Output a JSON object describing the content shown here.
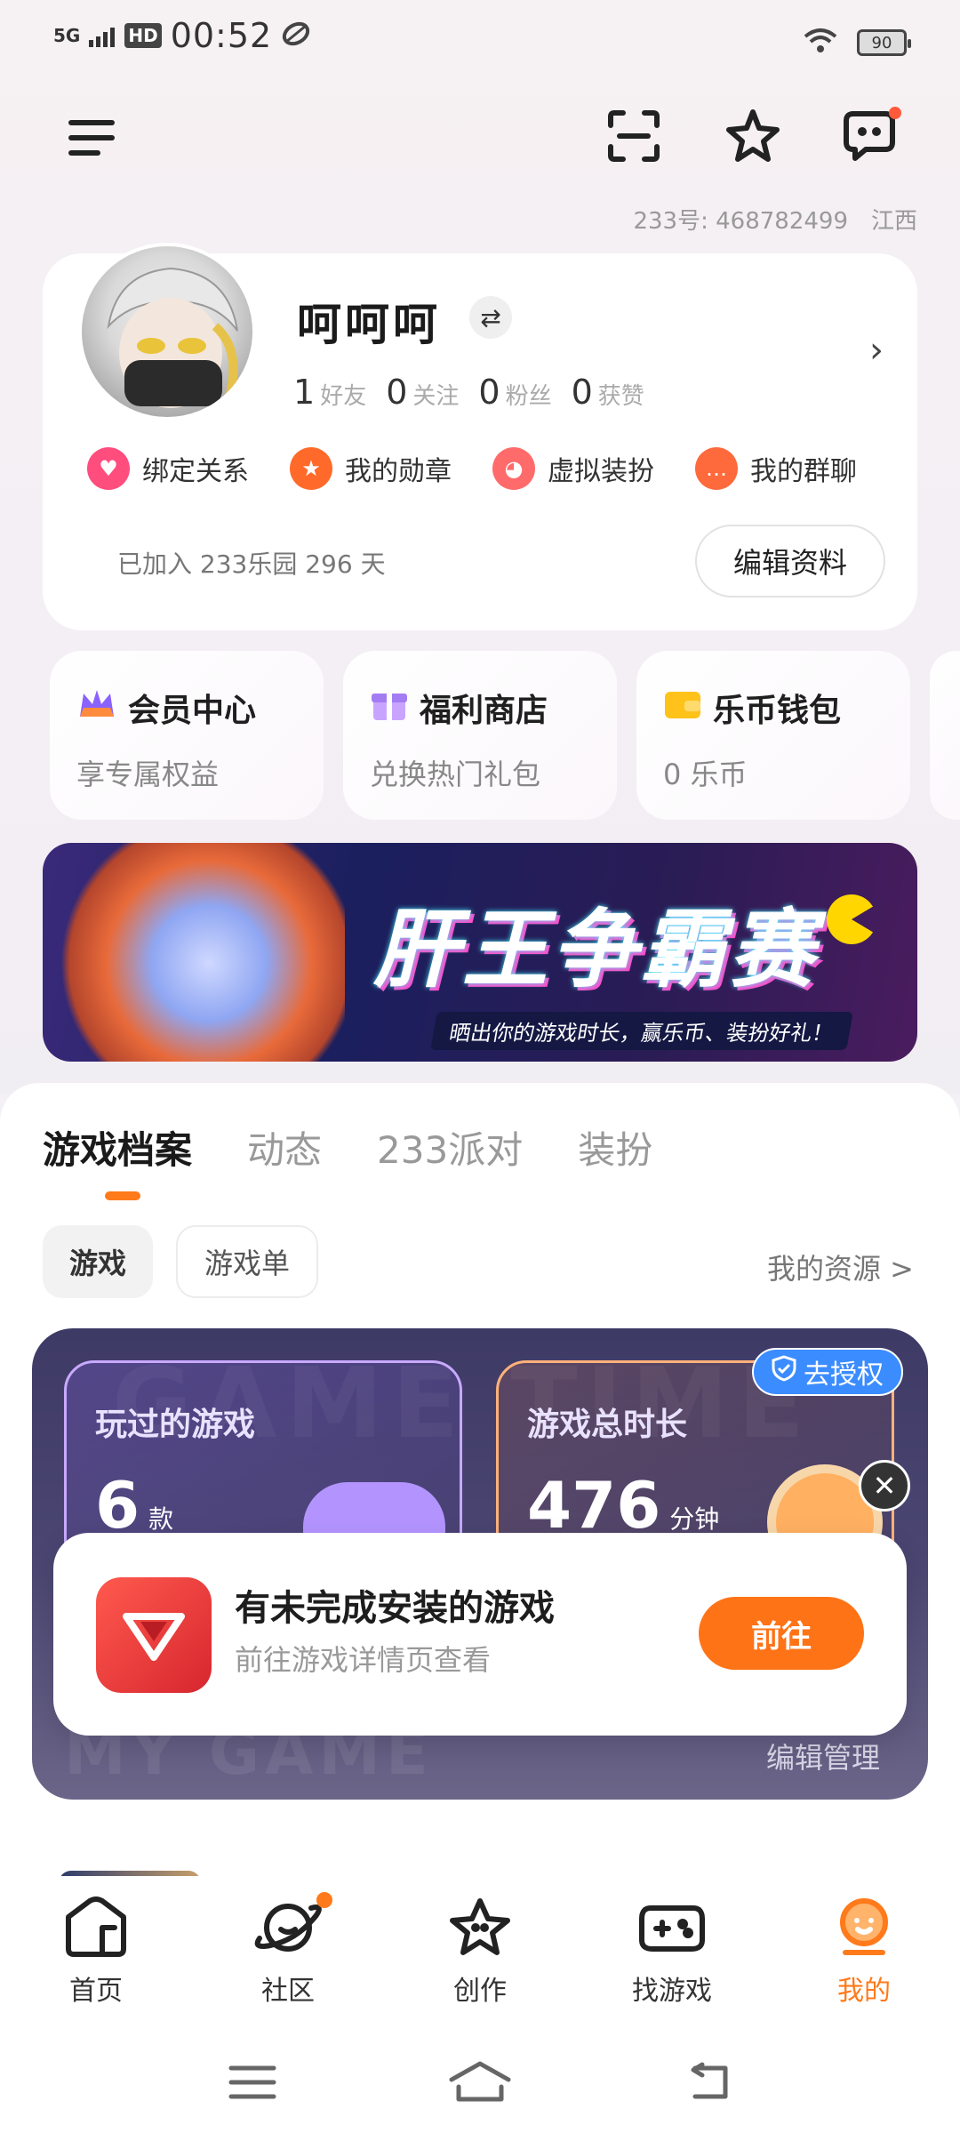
{
  "status_bar": {
    "network": "5G",
    "hd": "HD",
    "time": "00:52",
    "battery": "90"
  },
  "profile": {
    "id_label": "233号: 468782499",
    "location": "江西",
    "username": "呵呵呵",
    "stats": [
      {
        "value": "1",
        "label": "好友"
      },
      {
        "value": "0",
        "label": "关注"
      },
      {
        "value": "0",
        "label": "粉丝"
      },
      {
        "value": "0",
        "label": "获赞"
      }
    ],
    "quick_links": [
      {
        "label": "绑定关系",
        "icon": "heart-icon",
        "color": "#ff4d7d"
      },
      {
        "label": "我的勋章",
        "icon": "medal-icon",
        "color": "#ff6a2b"
      },
      {
        "label": "虚拟装扮",
        "icon": "cat-icon",
        "color": "#ff6b6b"
      },
      {
        "label": "我的群聊",
        "icon": "chat-icon",
        "color": "#ff6a3c"
      }
    ],
    "joined_text": "已加入 233乐园 296 天",
    "edit_button": "编辑资料"
  },
  "tiles": [
    {
      "title": "会员中心",
      "subtitle": "享专属权益",
      "icon": "crown-icon"
    },
    {
      "title": "福利商店",
      "subtitle": "兑换热门礼包",
      "icon": "gift-icon"
    },
    {
      "title": "乐币钱包",
      "subtitle": "0 乐币",
      "icon": "wallet-icon"
    }
  ],
  "banner": {
    "title": "肝王争霸赛",
    "subtitle": "晒出你的游戏时长，赢乐币、装扮好礼！"
  },
  "tabs": [
    "游戏档案",
    "动态",
    "233派对",
    "装扮"
  ],
  "chips": [
    "游戏",
    "游戏单"
  ],
  "my_resources": "我的资源 >",
  "game_card": {
    "watermark": "GAME TIME",
    "watermark2": "MY GAME",
    "played": {
      "label": "玩过的游戏",
      "value": "6",
      "unit": "款"
    },
    "duration": {
      "label": "游戏总时长",
      "value": "476",
      "unit": "分钟"
    },
    "auth_badge": "去授权",
    "edit_manage": "编辑管理"
  },
  "toast": {
    "title": "有未完成安装的游戏",
    "subtitle": "前往游戏详情页查看",
    "button": "前往"
  },
  "bottom_nav": [
    {
      "label": "首页",
      "icon": "home-icon"
    },
    {
      "label": "社区",
      "icon": "planet-icon"
    },
    {
      "label": "创作",
      "icon": "star-icon"
    },
    {
      "label": "找游戏",
      "icon": "gamepad-icon"
    },
    {
      "label": "我的",
      "icon": "profile-icon"
    }
  ],
  "colors": {
    "accent": "#ff7a1a",
    "go_button": "#ff7317",
    "auth_badge": "#3b8cff"
  }
}
